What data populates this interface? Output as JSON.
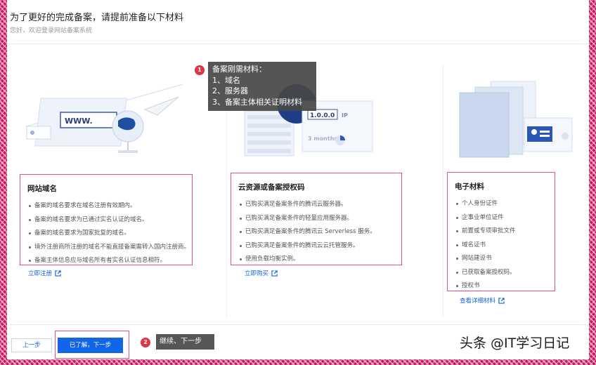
{
  "header": {
    "title": "为了更好的完成备案，请提前准备以下材料",
    "subtitle": "您好，欢迎登录网站备案系统"
  },
  "colors": {
    "accent": "#1165e6",
    "highlight_border": "#e0566f",
    "badge": "#e0344a"
  },
  "tooltip": {
    "badge": "1",
    "lines": [
      "备案刚需材料：",
      "1、域名",
      "2、服务器",
      "3、备案主体相关证明材料"
    ]
  },
  "illustrations": {
    "domain_text": "WWW.",
    "cloud_ip": "1.0.0.0",
    "cloud_ip_label": "IP",
    "cloud_months": "3 months"
  },
  "columns": [
    {
      "title": "网站域名",
      "items": [
        "备案的域名要求在域名注册有效期内。",
        "备案的域名要求为已通过实名认证的域名。",
        "备案的域名要求为国家批复的域名。",
        "境外注册商所注册的域名不能直接备案需转入国内注册商。",
        "备案主体信息应与域名所有者实名认证信息相符。"
      ],
      "link": "立即注册"
    },
    {
      "title": "云资源或备案授权码",
      "items": [
        "已购买满足备案条件的腾讯云服务器。",
        "已购买满足备案条件的轻量应用服务器。",
        "已购买满足备案条件的腾讯云 Serverless 服务。",
        "已购买满足备案条件的腾讯云云托管服务。",
        "使用负载均衡实例。"
      ],
      "link": "立即购买"
    },
    {
      "title": "电子材料",
      "items": [
        "个人身份证件",
        "企事业单位证件",
        "前置或专项审批文件",
        "域名证书",
        "网站建设书",
        "已获取备案授权码。",
        "授权书"
      ],
      "link": "查看详细材料"
    }
  ],
  "footer": {
    "prev_label": "上一步",
    "next_label": "已了解，下一步",
    "hint_badge": "2",
    "hint_text": "继续、下一步"
  },
  "watermark": "头条 @IT学习日记"
}
